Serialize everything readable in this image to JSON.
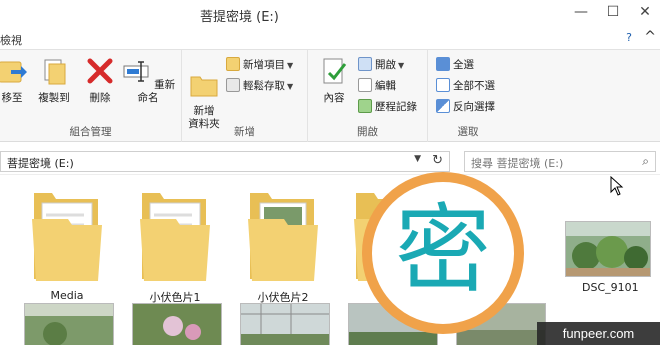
{
  "window": {
    "title": "菩提密境 (E:)",
    "min": "—",
    "max": "☐",
    "close": "✕"
  },
  "tabs": {
    "view": "檢視",
    "help": "?",
    "collapse": "^"
  },
  "ribbon": {
    "organize": {
      "label": "組合管理",
      "move_to": "移至",
      "copy_to": "複製到",
      "delete": "刪除",
      "rename": "重新命名"
    },
    "new": {
      "label": "新增",
      "new_folder": "新增\n資料夾",
      "new_item": "新增項目",
      "easy_access": "輕鬆存取"
    },
    "open": {
      "label": "開啟",
      "properties": "內容",
      "open": "開啟",
      "edit": "編輯",
      "history": "歷程記錄"
    },
    "select": {
      "label": "選取",
      "select_all": "全選",
      "select_none": "全部不選",
      "invert": "反向選擇"
    }
  },
  "address": {
    "path": "菩提密境 (E:)",
    "search_placeholder": "搜尋 菩提密境 (E:)"
  },
  "items": [
    {
      "name": "Media",
      "type": "folder"
    },
    {
      "name": "小伏色片1",
      "type": "folder"
    },
    {
      "name": "小伏色片2",
      "type": "folder"
    },
    {
      "name": "DSC_9101",
      "type": "photo"
    }
  ],
  "logo": {
    "char": "密"
  },
  "watermark": "funpeer.com",
  "colors": {
    "accent": "#1e5fae",
    "folder": "#f3d172",
    "logo_ring": "#f0a24a",
    "logo_text": "#1aa9b4"
  }
}
